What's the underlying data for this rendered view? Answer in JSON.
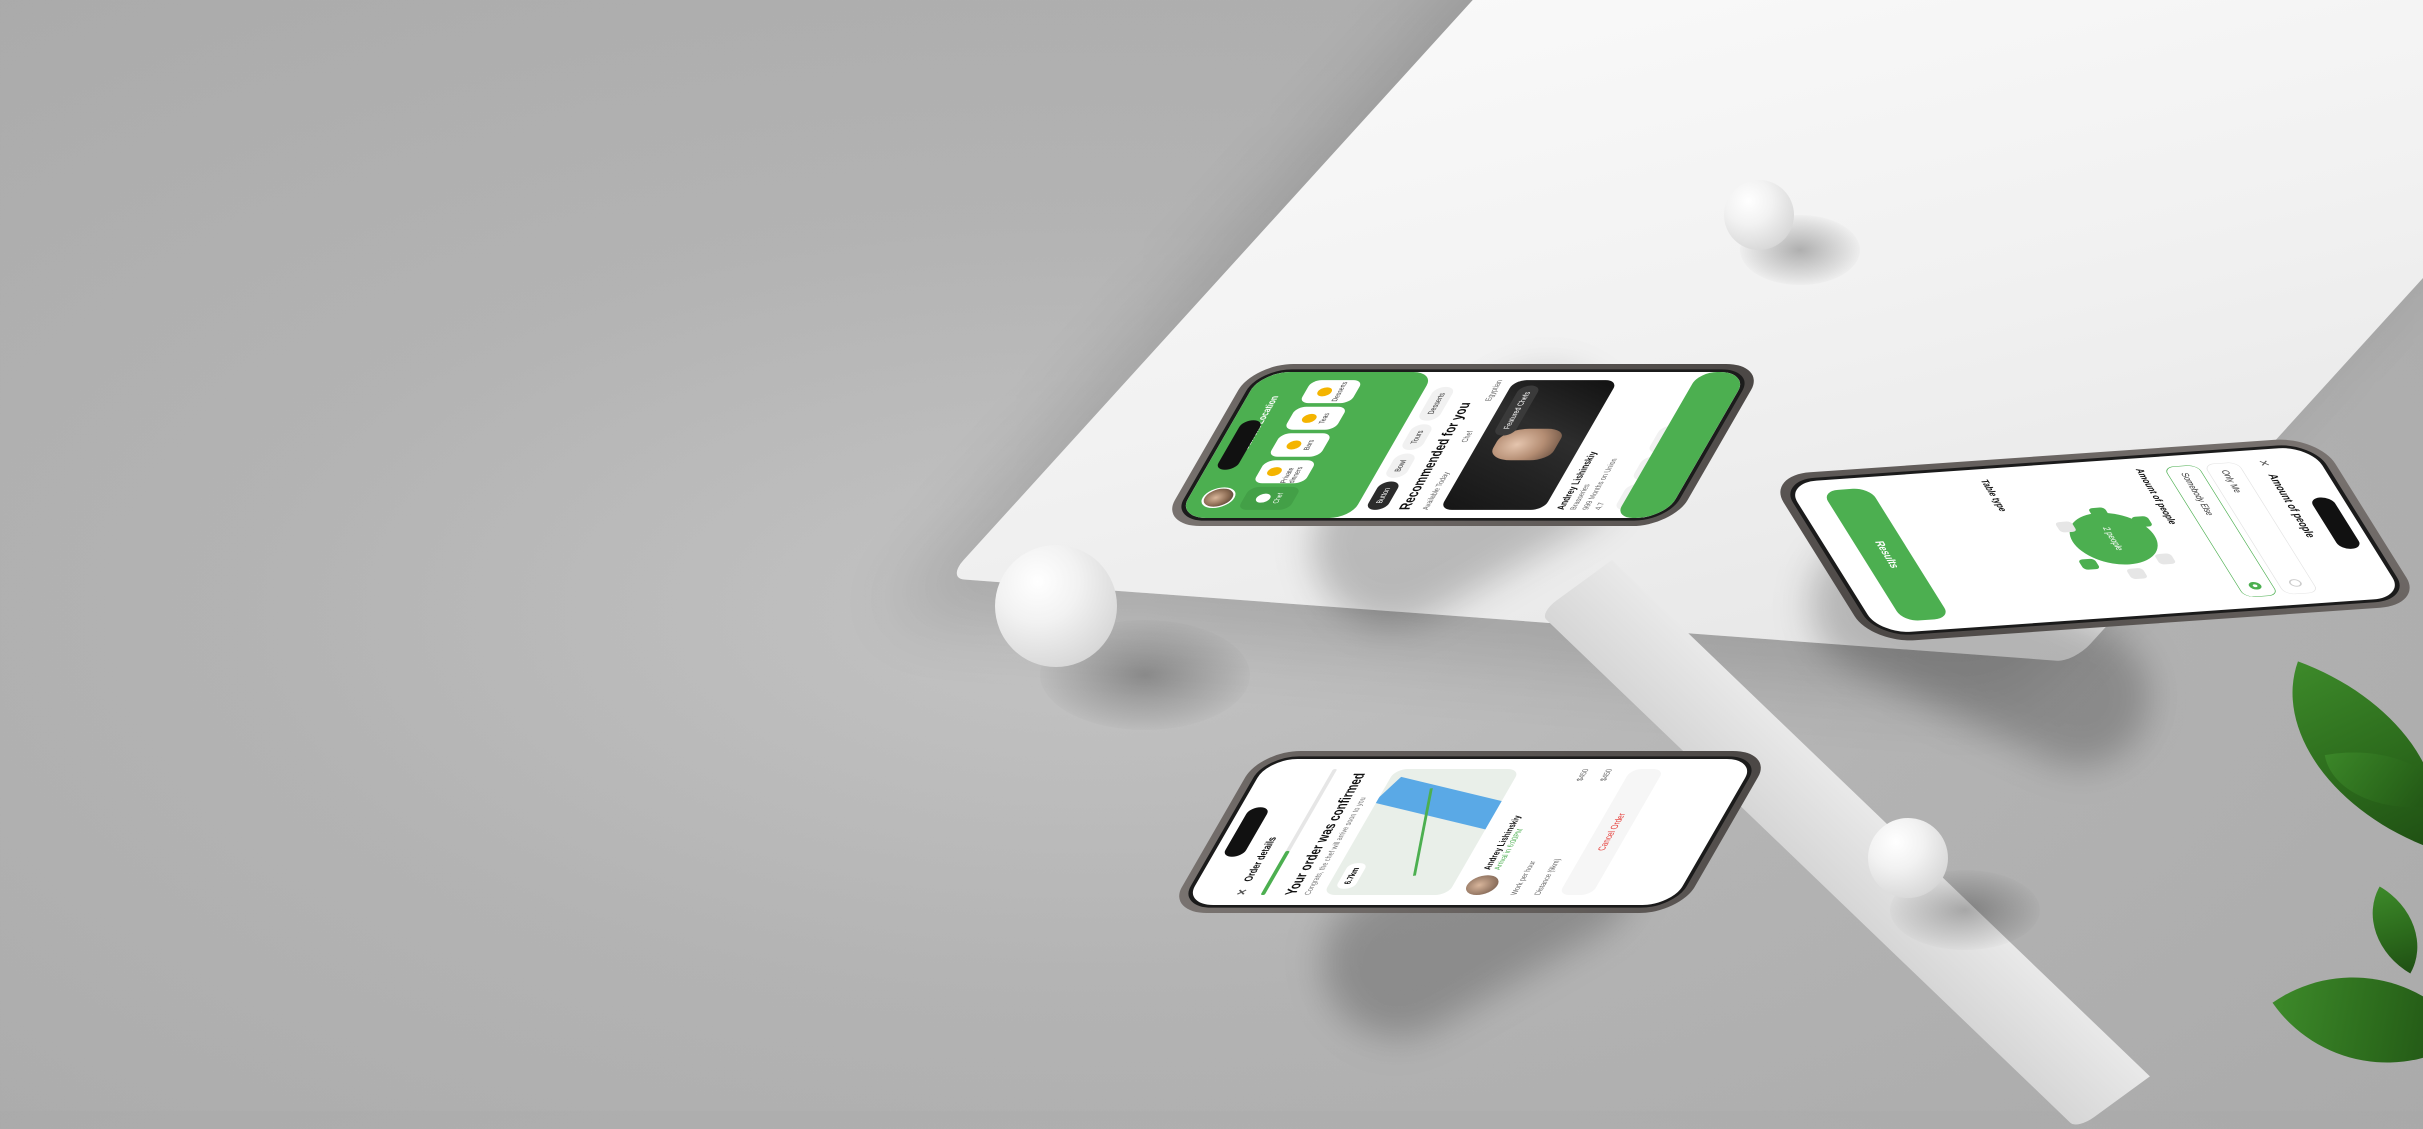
{
  "scene": {
    "accent_color": "#4caf50",
    "background_color": "#b3b3b3"
  },
  "phone_home": {
    "location_label": "Current Location",
    "categories": [
      "Chef",
      "Private dinners",
      "Bars",
      "Teas",
      "Desserts"
    ],
    "chips": [
      "Button",
      "Bowl",
      "Tours",
      "Desserts"
    ],
    "section_title": "Recommended for you",
    "tabs": [
      "Available Today",
      "Chef",
      "Egyptian"
    ],
    "featured_badge": "Featured Chefs",
    "chef_name": "Andrey Lishinskiy",
    "chef_specialty": "Brasseries",
    "chef_stat": "999 Months on Union",
    "chef_rating": "4.7",
    "tags": [
      "Asian",
      "Beef",
      "Italian"
    ]
  },
  "phone_order": {
    "header_title": "Order details",
    "progress_fraction": 0.35,
    "confirm_title": "Your order was confirmed",
    "confirm_subtitle": "Congrats, the chef will arrive soon to you",
    "map_distance": "6.7km",
    "courier_name": "Andrey Lishinskiy",
    "courier_eta": "Arrival in 6:00PM",
    "rows": [
      {
        "label": "Work per hour",
        "value": "$450"
      },
      {
        "label": "Distance (9km)",
        "value": "$450"
      }
    ],
    "cancel_label": "Cancel Order"
  },
  "phone_people": {
    "header_title": "Amount of people",
    "options": [
      "Only Me",
      "Somebody Else"
    ],
    "section_amount": "Amount of people",
    "section_table": "Table type",
    "table_label": "2 people",
    "cta_label": "Results"
  }
}
